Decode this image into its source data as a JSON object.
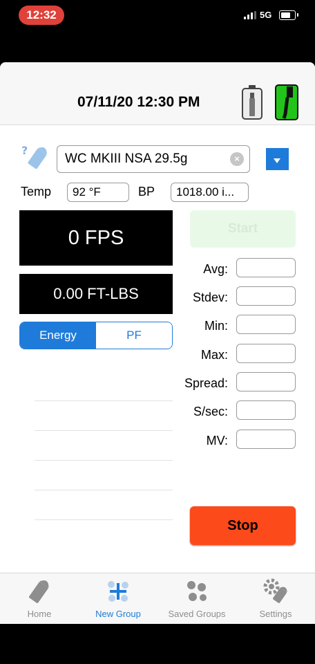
{
  "status_bar": {
    "time": "12:32",
    "network": "5G"
  },
  "header": {
    "datetime": "07/11/20 12:30 PM"
  },
  "projectile": {
    "name": "WC MKIII NSA 29.5g"
  },
  "conditions": {
    "temp_label": "Temp",
    "temp_value": "92 °F",
    "bp_label": "BP",
    "bp_value": "1018.00 i..."
  },
  "readouts": {
    "velocity": "0 FPS",
    "energy": "0.00 FT-LBS"
  },
  "segmented": {
    "energy": "Energy",
    "pf": "PF"
  },
  "controls": {
    "start": "Start",
    "stop": "Stop"
  },
  "stats": [
    {
      "label": "Avg:",
      "value": ""
    },
    {
      "label": "Stdev:",
      "value": ""
    },
    {
      "label": "Min:",
      "value": ""
    },
    {
      "label": "Max:",
      "value": ""
    },
    {
      "label": "Spread:",
      "value": ""
    },
    {
      "label": "S/sec:",
      "value": ""
    },
    {
      "label": "MV:",
      "value": ""
    }
  ],
  "tabs": [
    {
      "label": "Home",
      "icon": "home-icon"
    },
    {
      "label": "New Group",
      "icon": "new-group-icon",
      "active": true
    },
    {
      "label": "Saved Groups",
      "icon": "saved-groups-icon"
    },
    {
      "label": "Settings",
      "icon": "settings-icon"
    }
  ],
  "colors": {
    "accent": "#1e7bd9",
    "stop": "#fd4a1a",
    "start_disabled": "#e9f9e8",
    "status_time": "#e0413a",
    "connected": "#22c41a"
  }
}
